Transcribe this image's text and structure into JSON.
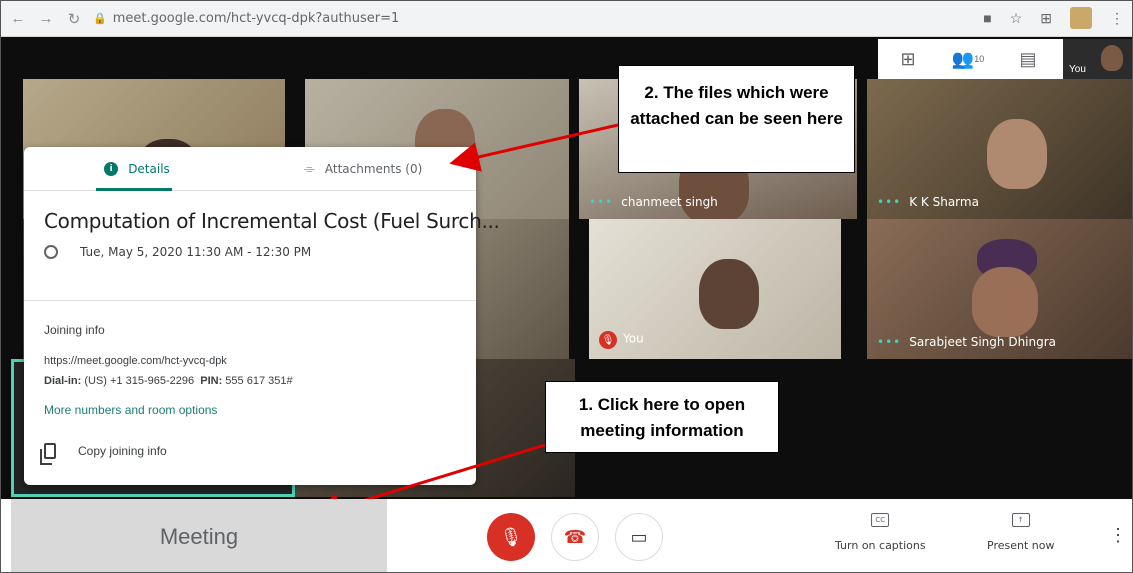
{
  "browser": {
    "url": "meet.google.com/hct-yvcq-dpk?authuser=1"
  },
  "meet_top": {
    "participants_count": "10",
    "self_label": "You"
  },
  "tiles": [
    {
      "name": ""
    },
    {
      "name": ""
    },
    {
      "name": "chanmeet singh"
    },
    {
      "name": "K K Sharma"
    },
    {
      "name": ""
    },
    {
      "name": ""
    },
    {
      "name": "You"
    },
    {
      "name": "Sarabjeet Singh Dhingra"
    }
  ],
  "details": {
    "tab_details": "Details",
    "tab_attachments": "Attachments (0)",
    "title": "Computation of Incremental Cost (Fuel Surch...",
    "time": "Tue, May 5, 2020 11:30 AM - 12:30 PM",
    "joining_label": "Joining info",
    "join_url": "https://meet.google.com/hct-yvcq-dpk",
    "dialin_label": "Dial-in:",
    "dialin_number": "(US) +1 315-965-2296",
    "pin_label": "PIN:",
    "pin_value": "555 617 351#",
    "more_link": "More numbers and room options",
    "copy_label": "Copy joining info"
  },
  "callouts": {
    "attachments_note": "2. The files which were attached can be seen here",
    "meeting_note": "1. Click here to open meeting information"
  },
  "bottom": {
    "meeting_label": "Meeting",
    "captions_icon_text": "CC",
    "captions_label": "Turn on captions",
    "present_label": "Present now"
  },
  "colors": {
    "accent": "#00796b",
    "danger": "#d93025",
    "tile_border": "#4fd1b6"
  }
}
